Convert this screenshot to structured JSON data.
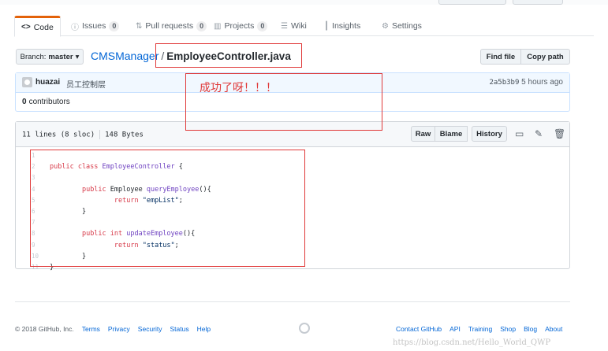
{
  "tabs": [
    {
      "icon": "code-icon",
      "glyph": "<>",
      "label": "Code",
      "count": ""
    },
    {
      "icon": "issue-icon",
      "glyph": "ⓘ",
      "label": "Issues",
      "count": "0"
    },
    {
      "icon": "pull-request-icon",
      "glyph": "⇅",
      "label": "Pull requests",
      "count": "0"
    },
    {
      "icon": "project-icon",
      "glyph": "▥",
      "label": "Projects",
      "count": "0"
    },
    {
      "icon": "wiki-icon",
      "glyph": "☰",
      "label": "Wiki",
      "count": ""
    },
    {
      "icon": "graph-icon",
      "glyph": "┃",
      "label": "Insights",
      "count": ""
    },
    {
      "icon": "gear-icon",
      "glyph": "⚙",
      "label": "Settings",
      "count": ""
    }
  ],
  "selected_tab": "Code",
  "branch": {
    "prefix": "Branch:",
    "name": "master",
    "caret": "▾"
  },
  "breadcrumb": {
    "repo": "CMSManager",
    "separator": "/",
    "file": "EmployeeController.java"
  },
  "file_actions": {
    "find_file": "Find file",
    "copy_path": "Copy path"
  },
  "commit": {
    "author": "huazai",
    "message": "员工控制层",
    "sha": "2a5b3b9",
    "time": "5 hours ago"
  },
  "contributors": {
    "count": "0",
    "label": "contributors"
  },
  "file_header": {
    "lines": "11 lines (8 sloc)",
    "size": "148 Bytes",
    "raw": "Raw",
    "blame": "Blame",
    "history": "History"
  },
  "code_lines": [
    {
      "n": "1",
      "text": ""
    },
    {
      "n": "2",
      "text": "public class EmployeeController {"
    },
    {
      "n": "3",
      "text": ""
    },
    {
      "n": "4",
      "text": "        public Employee queryEmployee(){"
    },
    {
      "n": "5",
      "text": "                return \"empList\";"
    },
    {
      "n": "6",
      "text": "        }"
    },
    {
      "n": "7",
      "text": ""
    },
    {
      "n": "8",
      "text": "        public int updateEmployee(){"
    },
    {
      "n": "9",
      "text": "                return \"status\";"
    },
    {
      "n": "10",
      "text": "        }"
    },
    {
      "n": "11",
      "text": "}"
    }
  ],
  "annotation": "成功了呀！！！",
  "footer": {
    "copyright": "© 2018 GitHub, Inc.",
    "left_links": [
      "Terms",
      "Privacy",
      "Security",
      "Status",
      "Help"
    ],
    "right_links": [
      "Contact GitHub",
      "API",
      "Training",
      "Shop",
      "Blog",
      "About"
    ]
  },
  "watermark": "https://blog.csdn.net/Hello_World_QWP",
  "colors": {
    "link": "#0366d6",
    "annotation": "#e03838",
    "selected_tab_accent": "#e36209"
  }
}
